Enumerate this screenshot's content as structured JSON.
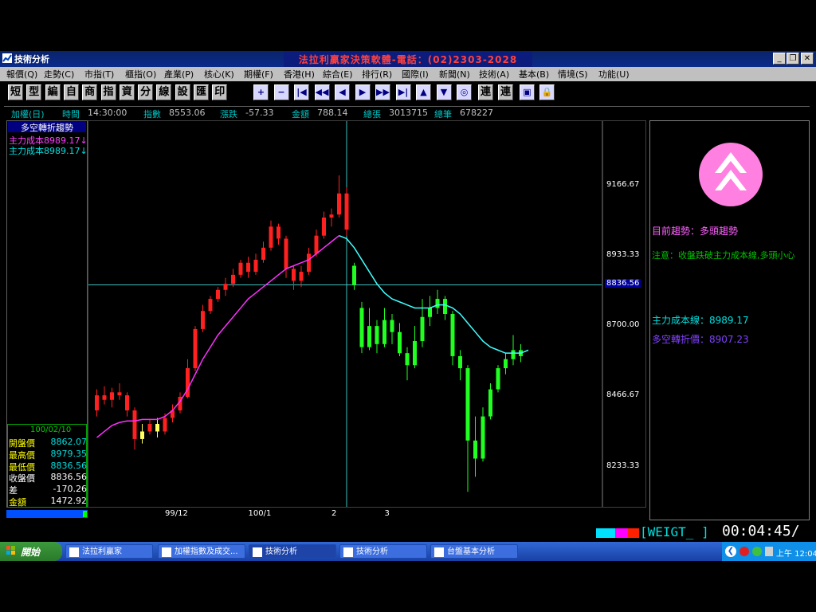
{
  "window": {
    "app_title": "技術分析",
    "vendor_banner": "法拉利贏家決策軟體-電話：(02)2303-2028"
  },
  "menu": [
    "報價(Q)",
    "走勢(C)",
    "市指(T)",
    "櫃指(O)",
    "產業(P)",
    "核心(K)",
    "期權(F)",
    "香港(H)",
    "綜合(E)",
    "排行(R)",
    "國際(I)",
    "新聞(N)",
    "技術(A)",
    "基本(B)",
    "情境(S)",
    "功能(U)"
  ],
  "toolbar_chars": [
    "短",
    "型",
    "編",
    "自",
    "商",
    "指",
    "資",
    "分",
    "線",
    "設",
    "匯",
    "印"
  ],
  "toolbar_extra": [
    "連",
    "連"
  ],
  "info": {
    "symbol": "加權(日)",
    "time_label": "時間",
    "time": "14:30:00",
    "index_label": "指數",
    "index": "8553.06",
    "change_label": "漲跌",
    "change": "-57.33",
    "amount_label": "金額",
    "amount": "788.14",
    "volume_label": "總張",
    "volume": "3013715",
    "trades_label": "總筆",
    "trades": "678227"
  },
  "left": {
    "title": "多空轉折趨勢",
    "line1": "主力成本8989.17↓",
    "line2": "主力成本8989.17↓",
    "date": "100/02/10",
    "stats": [
      {
        "label": "開盤價",
        "value": "8862.07"
      },
      {
        "label": "最高價",
        "value": "8979.35"
      },
      {
        "label": "最低價",
        "value": "8836.56"
      },
      {
        "label": "收盤價",
        "value": "8836.56"
      },
      {
        "label": "差",
        "value": "-170.26"
      },
      {
        "label": "金額",
        "value": "1472.92"
      }
    ]
  },
  "right": {
    "trend_label": "目前趨勢：多頭趨勢",
    "note": "注意：收盤跌破主力成本線,多頭小心",
    "cost_line": "主力成本線：8989.17",
    "turn_price": "多空轉折價：8907.23"
  },
  "status": {
    "code": "[WEIGT_ ]",
    "timer": "00:04:45/"
  },
  "taskbar": {
    "start": "開始",
    "items": [
      "法拉利贏家",
      "加權指數及成交...",
      "技術分析",
      "技術分析",
      "台盤基本分析"
    ],
    "clock": "上午 12:04"
  },
  "chart_data": {
    "type": "candlestick",
    "yticks": [
      8233.33,
      8466.67,
      8700.0,
      8933.33,
      9166.67
    ],
    "ylim": [
      8100,
      9380
    ],
    "xticks": [
      {
        "label": "99/12",
        "index": 10
      },
      {
        "label": "100/1",
        "index": 21
      },
      {
        "label": "2",
        "index": 32
      },
      {
        "label": "3",
        "index": 39
      }
    ],
    "crosshair": {
      "price": 8836.56,
      "label": "8836.56",
      "index": 33
    },
    "candles": [
      [
        8420,
        8470,
        8400,
        8490
      ],
      [
        8470,
        8455,
        8440,
        8500
      ],
      [
        8455,
        8480,
        8430,
        8495
      ],
      [
        8480,
        8470,
        8455,
        8510
      ],
      [
        8470,
        8420,
        8400,
        8480
      ],
      [
        8420,
        8325,
        8290,
        8430
      ],
      [
        8325,
        8350,
        8310,
        8375
      ],
      [
        8350,
        8375,
        8340,
        8390
      ],
      [
        8375,
        8350,
        8330,
        8395
      ],
      [
        8350,
        8395,
        8340,
        8410
      ],
      [
        8395,
        8420,
        8380,
        8440
      ],
      [
        8420,
        8465,
        8410,
        8480
      ],
      [
        8465,
        8560,
        8460,
        8590
      ],
      [
        8560,
        8690,
        8550,
        8700
      ],
      [
        8690,
        8750,
        8680,
        8770
      ],
      [
        8750,
        8790,
        8740,
        8800
      ],
      [
        8790,
        8820,
        8780,
        8830
      ],
      [
        8820,
        8840,
        8800,
        8860
      ],
      [
        8840,
        8870,
        8830,
        8890
      ],
      [
        8870,
        8910,
        8860,
        8920
      ],
      [
        8910,
        8880,
        8860,
        8930
      ],
      [
        8880,
        8920,
        8870,
        8940
      ],
      [
        8920,
        8960,
        8910,
        8980
      ],
      [
        8960,
        9030,
        8950,
        9050
      ],
      [
        9030,
        8990,
        8970,
        9040
      ],
      [
        8990,
        8890,
        8860,
        9000
      ],
      [
        8890,
        8850,
        8820,
        8900
      ],
      [
        8850,
        8880,
        8830,
        8900
      ],
      [
        8880,
        8940,
        8870,
        8960
      ],
      [
        8940,
        9000,
        8930,
        9020
      ],
      [
        9000,
        9060,
        8990,
        9080
      ],
      [
        9060,
        9070,
        9030,
        9090
      ],
      [
        9070,
        9140,
        9060,
        9200
      ],
      [
        9140,
        9020,
        9000,
        9160
      ],
      [
        8900,
        8836,
        8820,
        8910
      ],
      [
        8760,
        8630,
        8610,
        8780
      ],
      [
        8630,
        8700,
        8620,
        8760
      ],
      [
        8700,
        8640,
        8610,
        8720
      ],
      [
        8640,
        8720,
        8630,
        8760
      ],
      [
        8720,
        8680,
        8640,
        8740
      ],
      [
        8680,
        8610,
        8600,
        8710
      ],
      [
        8610,
        8570,
        8520,
        8630
      ],
      [
        8570,
        8650,
        8560,
        8700
      ],
      [
        8650,
        8730,
        8630,
        8790
      ],
      [
        8730,
        8760,
        8700,
        8800
      ],
      [
        8760,
        8790,
        8740,
        8820
      ],
      [
        8790,
        8740,
        8720,
        8800
      ],
      [
        8740,
        8600,
        8570,
        8750
      ],
      [
        8600,
        8560,
        8520,
        8620
      ],
      [
        8560,
        8320,
        8150,
        8570
      ],
      [
        8320,
        8260,
        8200,
        8400
      ],
      [
        8260,
        8400,
        8250,
        8430
      ],
      [
        8400,
        8490,
        8390,
        8510
      ],
      [
        8490,
        8560,
        8480,
        8570
      ],
      [
        8560,
        8590,
        8540,
        8610
      ],
      [
        8590,
        8620,
        8570,
        8670
      ],
      [
        8620,
        8600,
        8580,
        8640
      ]
    ],
    "ma_pink": [
      8330,
      8350,
      8370,
      8380,
      8385,
      8385,
      8390,
      8390,
      8390,
      8400,
      8420,
      8450,
      8490,
      8540,
      8590,
      8630,
      8670,
      8700,
      8730,
      8760,
      8790,
      8810,
      8830,
      8850,
      8870,
      8890,
      8900,
      8910,
      8920,
      8940,
      8960,
      8980,
      9000
    ],
    "ma_cyan": [
      8990,
      8960,
      8920,
      8880,
      8840,
      8810,
      8790,
      8780,
      8770,
      8760,
      8760,
      8760,
      8770,
      8770,
      8760,
      8740,
      8710,
      8680,
      8650,
      8630,
      8620,
      8610,
      8610,
      8610,
      8620
    ]
  }
}
